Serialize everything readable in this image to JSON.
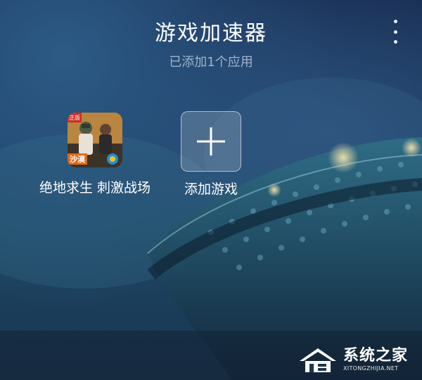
{
  "header": {
    "title": "游戏加速器",
    "subtitle": "已添加1个应用"
  },
  "menu": {
    "icon": "more-vertical-icon"
  },
  "apps": [
    {
      "label": "绝地求生 刺激战场",
      "icon": "pubg-game-icon",
      "badge_top": "正版",
      "badge_bottom": "沙漠"
    },
    {
      "label": "添加游戏",
      "icon": "plus-icon"
    }
  ],
  "watermark": {
    "text": "系统之家",
    "url": "XITONGZHIJIA.NET"
  },
  "colors": {
    "background_top": "#1a2f55",
    "background_bottom": "#1a3550",
    "subtitle": "#9fb3cc",
    "text": "#ffffff"
  }
}
